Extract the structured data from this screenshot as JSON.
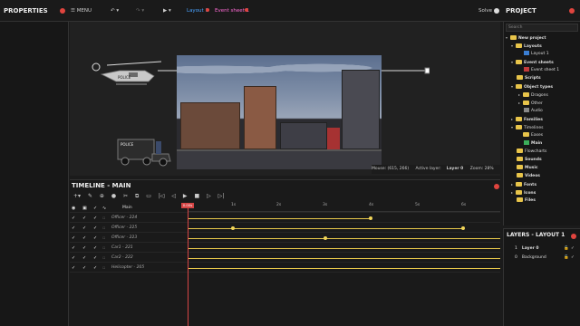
{
  "panels": {
    "properties_title": "PROPERTIES",
    "project_title": "PROJECT",
    "timeline_title": "TIMELINE - MAIN",
    "layers_title": "LAYERS - LAYOUT 1"
  },
  "toolbar": {
    "menu_label": "MENU",
    "solve_label": "Solve"
  },
  "tabs": [
    {
      "label": "Layout 1"
    },
    {
      "label": "Event sheet 1"
    }
  ],
  "status_bar": {
    "mouse": "Mouse: (615, 266)",
    "active_layer_label": "Active layer:",
    "active_layer_value": "Layer 0",
    "zoom": "Zoom: 28%"
  },
  "project": {
    "search_placeholder": "Search",
    "tree": [
      {
        "label": "New project"
      },
      {
        "label": "Layouts"
      },
      {
        "label": "Layout 1"
      },
      {
        "label": "Event sheets"
      },
      {
        "label": "Event sheet 1"
      },
      {
        "label": "Scripts"
      },
      {
        "label": "Object types"
      },
      {
        "label": "Dragons"
      },
      {
        "label": "Other"
      },
      {
        "label": "Audio"
      },
      {
        "label": "Families"
      },
      {
        "label": "Timelines"
      },
      {
        "label": "Eases"
      },
      {
        "label": "Main"
      },
      {
        "label": "Flowcharts"
      },
      {
        "label": "Sounds"
      },
      {
        "label": "Music"
      },
      {
        "label": "Videos"
      },
      {
        "label": "Fonts"
      },
      {
        "label": "Icons"
      },
      {
        "label": "Files"
      }
    ]
  },
  "layers": [
    {
      "index": "1",
      "name": "Layer 0"
    },
    {
      "index": "0",
      "name": "Background"
    }
  ],
  "timeline": {
    "root_label": "Main",
    "playhead_label": "0.00s",
    "ruler": [
      "1s",
      "2s",
      "3s",
      "4s",
      "5s",
      "6s"
    ],
    "tracks": [
      {
        "name": "Officer - 224"
      },
      {
        "name": "Officer - 225"
      },
      {
        "name": "Officer - 223"
      },
      {
        "name": "Car1 - 221"
      },
      {
        "name": "Car2 - 222"
      },
      {
        "name": "Helicopter - 205"
      }
    ]
  },
  "colors": {
    "accent_tab": "#4aa3ff",
    "event_tab": "#ff6ad5",
    "track": "#e8c84a",
    "playhead": "#d64545"
  }
}
